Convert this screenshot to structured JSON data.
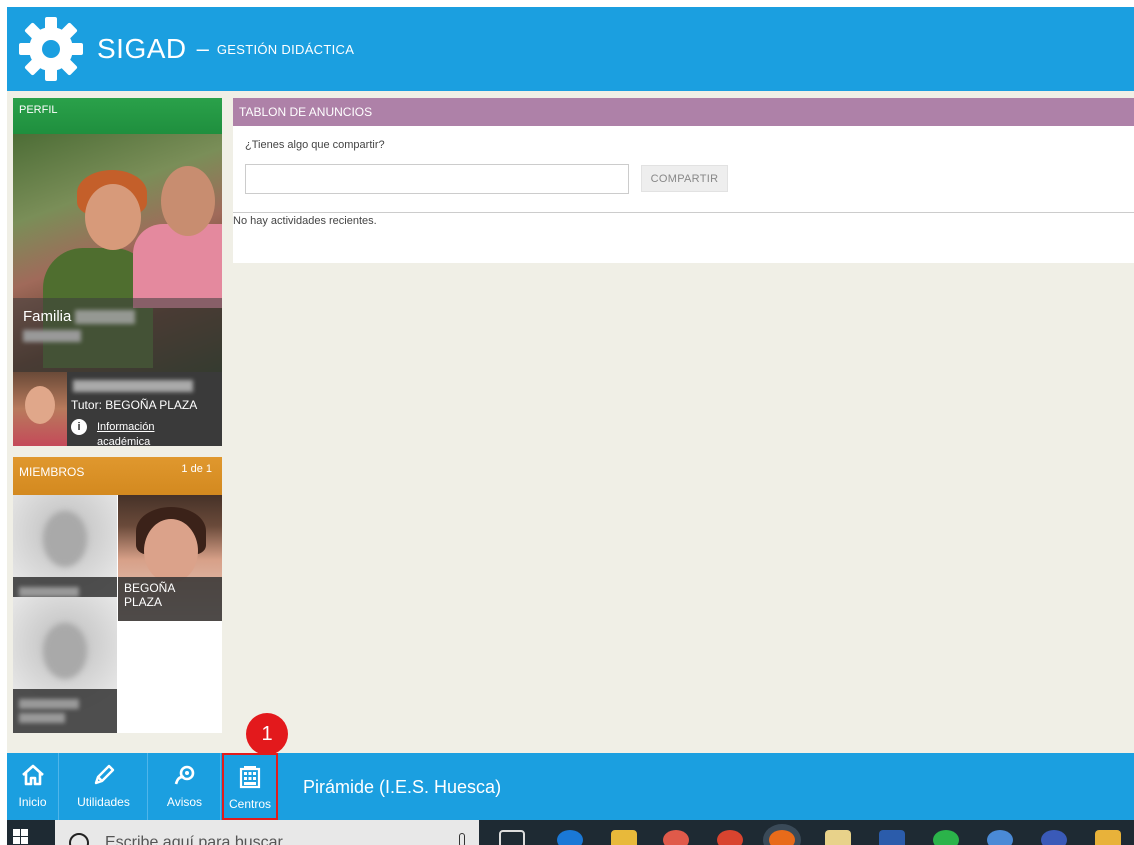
{
  "header": {
    "title": "SIGAD",
    "separator": "–",
    "subtitle": "Gestión Didáctica"
  },
  "profile": {
    "section_label": "PERFIL",
    "family_label": "Familia",
    "tutor": "Tutor: BEGOÑA PLAZA",
    "info_link": "Información académica"
  },
  "members": {
    "section_label": "MIEMBROS",
    "count": "1 de 1",
    "items": [
      {
        "name": ""
      },
      {
        "name": "BEGOÑA PLAZA"
      },
      {
        "name": ""
      }
    ]
  },
  "board": {
    "title": "TABLON DE ANUNCIOS",
    "share_question": "¿Tienes algo que compartir?",
    "share_input_value": "",
    "share_button": "COMPARTIR",
    "empty_message": "No hay actividades recientes."
  },
  "bottom_nav": {
    "items": [
      {
        "label": "Inicio",
        "icon": "home-icon"
      },
      {
        "label": "Utilidades",
        "icon": "pencil-icon"
      },
      {
        "label": "Avisos",
        "icon": "megaphone-icon"
      },
      {
        "label": "Centros",
        "icon": "building-icon"
      }
    ],
    "site_name": "Pirámide (I.E.S. Huesca)"
  },
  "annotation": {
    "step_number": "1"
  },
  "taskbar": {
    "search_placeholder": "Escribe aquí para buscar"
  },
  "colors": {
    "primary_blue": "#1b9fe0",
    "profile_green": "#2aa14a",
    "members_orange": "#e0982e",
    "board_purple": "#ae81a8",
    "highlight_red": "#e21b1b",
    "content_bg": "#f0efe6"
  }
}
